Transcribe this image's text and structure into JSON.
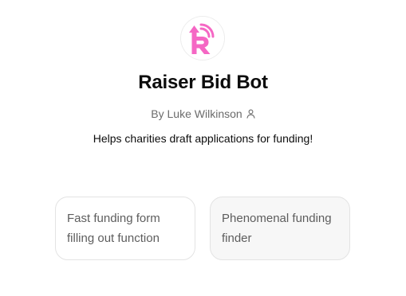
{
  "bot": {
    "name": "Raiser Bid Bot",
    "author": "By Luke Wilkinson",
    "description": "Helps charities draft applications for funding!",
    "logo_icon": "raiser-r-logo",
    "brand_color": "#f567c4"
  },
  "starters": [
    {
      "label": "Fast funding form filling out function"
    },
    {
      "label": "Phenomenal funding finder"
    }
  ]
}
